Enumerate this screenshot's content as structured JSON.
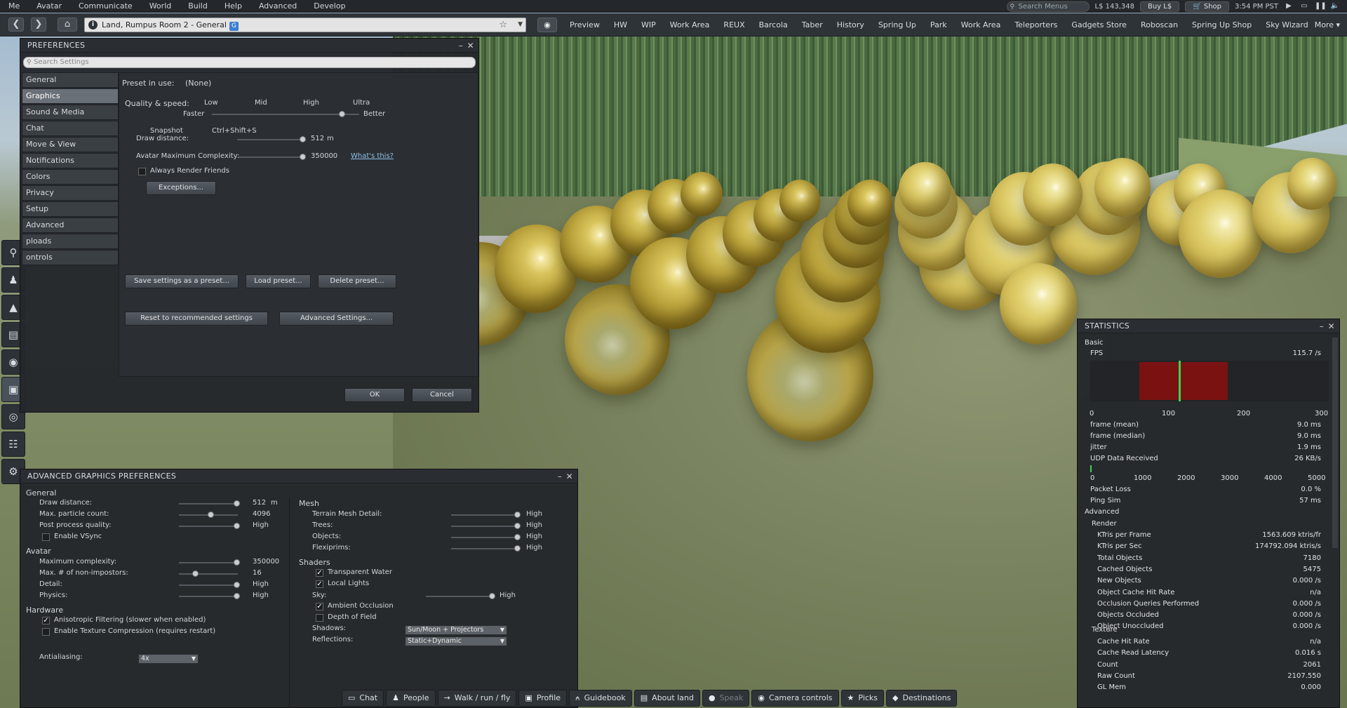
{
  "menubar": {
    "items": [
      "Me",
      "Avatar",
      "Communicate",
      "World",
      "Build",
      "Help",
      "Advanced",
      "Develop"
    ],
    "search_placeholder": "Search Menus",
    "balance": "L$ 143,348",
    "buy_label": "Buy L$",
    "shop_label": "Shop",
    "clock": "3:54 PM PST"
  },
  "navbar": {
    "location": "Land, Rumpus Room 2 - General",
    "maturity_badge": "G",
    "favorites": [
      "Preview",
      "HW",
      "WIP",
      "Work Area",
      "REUX",
      "Barcola",
      "Taber",
      "History",
      "Spring Up",
      "Park",
      "Work Area",
      "Teleporters",
      "Gadgets Store",
      "Roboscan",
      "Spring Up Shop",
      "Sky Wizard"
    ],
    "more_label": "More ▾"
  },
  "lefttools": [
    "search-icon",
    "people-icon",
    "shirt-icon",
    "inventory-icon",
    "places-icon",
    "snapshot-icon",
    "radar-icon",
    "map-icon",
    "settings-icon"
  ],
  "preferences": {
    "title": "PREFERENCES",
    "search_placeholder": "Search Settings",
    "tabs": [
      "General",
      "Graphics",
      "Sound & Media",
      "Chat",
      "Move & View",
      "Notifications",
      "Colors",
      "Privacy",
      "Setup",
      "Advanced",
      "ploads",
      "ontrols"
    ],
    "selected_tab": "Graphics",
    "preset_label": "Preset in use:",
    "preset_value": "(None)",
    "quality_label": "Quality & speed:",
    "quality_levels": [
      "Low",
      "Mid",
      "High",
      "Ultra"
    ],
    "faster_label": "Faster",
    "better_label": "Better",
    "quality_fraction": 0.86,
    "snapshot_label": "Snapshot",
    "snapshot_shortcut": "Ctrl+Shift+S",
    "draw_distance_label": "Draw distance:",
    "draw_distance_value": "512",
    "draw_distance_unit": "m",
    "avatar_complexity_label": "Avatar Maximum Complexity:",
    "avatar_complexity_value": "350000",
    "whats_this": "What's this?",
    "always_render_friends": "Always Render Friends",
    "exceptions_button": "Exceptions...",
    "save_preset": "Save settings as a preset...",
    "load_preset": "Load preset...",
    "delete_preset": "Delete preset...",
    "reset_recommended": "Reset to recommended settings",
    "advanced_settings": "Advanced Settings...",
    "ok": "OK",
    "cancel": "Cancel"
  },
  "advanced_graphics": {
    "title": "ADVANCED GRAPHICS PREFERENCES",
    "general_header": "General",
    "draw_distance_label": "Draw distance:",
    "draw_distance_value": "512",
    "draw_distance_unit": "m",
    "max_particle_label": "Max. particle count:",
    "max_particle_value": "4096",
    "post_process_label": "Post process quality:",
    "post_process_value": "High",
    "vsync_label": "Enable VSync",
    "avatar_header": "Avatar",
    "max_complexity_label": "Maximum complexity:",
    "max_complexity_value": "350000",
    "non_impostors_label": "Max. # of non-impostors:",
    "non_impostors_value": "16",
    "detail_label": "Detail:",
    "detail_value": "High",
    "physics_label": "Physics:",
    "physics_value": "High",
    "hardware_header": "Hardware",
    "anisotropic_label": "Anisotropic Filtering (slower when enabled)",
    "texture_compression_label": "Enable Texture Compression (requires restart)",
    "antialiasing_label": "Antialiasing:",
    "antialiasing_value": "4x",
    "mesh_header": "Mesh",
    "terrain_mesh_label": "Terrain Mesh Detail:",
    "terrain_mesh_value": "High",
    "trees_label": "Trees:",
    "trees_value": "High",
    "objects_label": "Objects:",
    "objects_value": "High",
    "flexiprims_label": "Flexiprims:",
    "flexiprims_value": "High",
    "shaders_header": "Shaders",
    "transparent_water_label": "Transparent Water",
    "local_lights_label": "Local Lights",
    "sky_label": "Sky:",
    "sky_value": "High",
    "ambient_occlusion_label": "Ambient Occlusion",
    "depth_of_field_label": "Depth of Field",
    "shadows_label": "Shadows:",
    "shadows_value": "Sun/Moon + Projectors",
    "reflections_label": "Reflections:",
    "reflections_value": "Static+Dynamic"
  },
  "statistics": {
    "title": "STATISTICS",
    "basic_header": "Basic",
    "fps_label": "FPS",
    "fps_value": "115.7 /s",
    "fps_axis": [
      "0",
      "100",
      "200",
      "300"
    ],
    "frame_mean_label": "frame (mean)",
    "frame_mean_value": "9.0 ms",
    "frame_median_label": "frame (median)",
    "frame_median_value": "9.0 ms",
    "jitter_label": "jitter",
    "jitter_value": "1.9 ms",
    "udp_label": "UDP Data Received",
    "udp_value": "26 KB/s",
    "udp_axis": [
      "0",
      "1000",
      "2000",
      "3000",
      "4000",
      "5000"
    ],
    "packet_loss_label": "Packet Loss",
    "packet_loss_value": "0.0 %",
    "ping_label": "Ping Sim",
    "ping_value": "57 ms",
    "advanced_header": "Advanced",
    "render_header": "Render",
    "render_rows": [
      {
        "label": "KTris per Frame",
        "value": "1563.609 ktris/fr"
      },
      {
        "label": "KTris per Sec",
        "value": "174792.094 ktris/s"
      },
      {
        "label": "Total Objects",
        "value": "7180"
      },
      {
        "label": "Cached Objects",
        "value": "5475"
      },
      {
        "label": "New Objects",
        "value": "0.000 /s"
      },
      {
        "label": "Object Cache Hit Rate",
        "value": "n/a"
      },
      {
        "label": "Occlusion Queries Performed",
        "value": "0.000 /s"
      },
      {
        "label": "Objects Occluded",
        "value": "0.000 /s"
      },
      {
        "label": "Object Unoccluded",
        "value": "0.000 /s"
      }
    ],
    "texture_header": "Texture",
    "texture_rows": [
      {
        "label": "Cache Hit Rate",
        "value": "n/a"
      },
      {
        "label": "Cache Read Latency",
        "value": "0.016 s"
      },
      {
        "label": "Count",
        "value": "2061"
      },
      {
        "label": "Raw Count",
        "value": "2107.550"
      },
      {
        "label": "GL Mem",
        "value": "0.000"
      }
    ]
  },
  "bottombar": [
    {
      "label": "Chat",
      "icon": "chat-icon",
      "enabled": true
    },
    {
      "label": "People",
      "icon": "people-icon",
      "enabled": true
    },
    {
      "label": "Walk / run / fly",
      "icon": "walk-icon",
      "enabled": true
    },
    {
      "label": "Profile",
      "icon": "profile-icon",
      "enabled": true
    },
    {
      "label": "Guidebook",
      "icon": "guidebook-icon",
      "enabled": true
    },
    {
      "label": "About land",
      "icon": "about-land-icon",
      "enabled": true
    },
    {
      "label": "Speak",
      "icon": "microphone-icon",
      "enabled": false
    },
    {
      "label": "Camera controls",
      "icon": "camera-icon",
      "enabled": true
    },
    {
      "label": "Picks",
      "icon": "picks-icon",
      "enabled": true
    },
    {
      "label": "Destinations",
      "icon": "destinations-icon",
      "enabled": true
    }
  ]
}
